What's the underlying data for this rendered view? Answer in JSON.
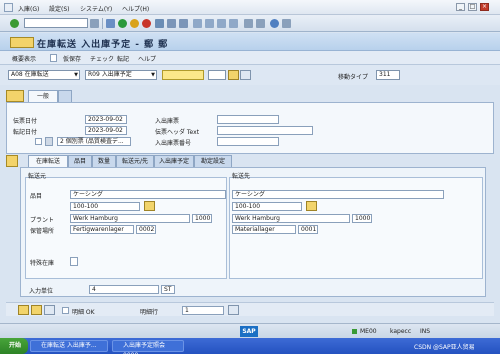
{
  "menu": {
    "items": [
      "入庫(G)",
      "設定(S)",
      "システム(Y)",
      "ヘルプ(H)"
    ]
  },
  "title": "在庫転送 入出庫予定 - 郵 郵",
  "app_toolbar": [
    "概要表示",
    "仮保存",
    "チェック",
    "転記",
    "ヘルプ"
  ],
  "selection": {
    "movement": "A08 在庫転送",
    "reference": "R09 入出庫予定",
    "movement_type_label": "移動タイプ",
    "movement_type_value": "311"
  },
  "header_tabs": [
    "一般"
  ],
  "header": {
    "doc_date_label": "伝票日付",
    "doc_date": "2023-09-02",
    "post_date_label": "転記日付",
    "post_date": "2023-09-02",
    "print_option": "2 個別票 (品質検査デ...",
    "slip_label": "入出庫票",
    "header_text_label": "伝票ヘッダ Text",
    "slip_no_label": "入出庫票番号"
  },
  "item_tabs": [
    "在庫転送",
    "品目",
    "数量",
    "転送元/先",
    "入出庫予定",
    "勘定設定"
  ],
  "item": {
    "from_group": "転送元",
    "to_group": "転送先",
    "material_label": "品目",
    "material_from": "ケーシング",
    "material_to": "ケーシング",
    "material_no_from": "100-100",
    "material_no_to": "100-100",
    "plant_label": "プラント",
    "plant_from_name": "Werk Hamburg",
    "plant_from": "1000",
    "plant_to_name": "Werk Hamburg",
    "plant_to": "1000",
    "sloc_label": "保管場所",
    "sloc_from_name": "Fertigwarenlager",
    "sloc_from": "0002",
    "sloc_to_name": "Materiallager",
    "sloc_to": "0001",
    "special_stock_label": "特殊在庫",
    "qty_label": "入力単位",
    "qty": "4",
    "uom": "ST"
  },
  "bottom": {
    "detail_ok": "明細 OK",
    "line_label": "明細行",
    "line_no": "1"
  },
  "status": {
    "sap": "SAP",
    "system": "ME00",
    "server": "kapecc",
    "mode": "INS"
  },
  "taskbar": {
    "start": "开始",
    "task1": "在庫転送 入出庫予...",
    "task2": "入出庫予定照会 0000...",
    "watermark": "CSDN @SAP亚人贸易"
  }
}
